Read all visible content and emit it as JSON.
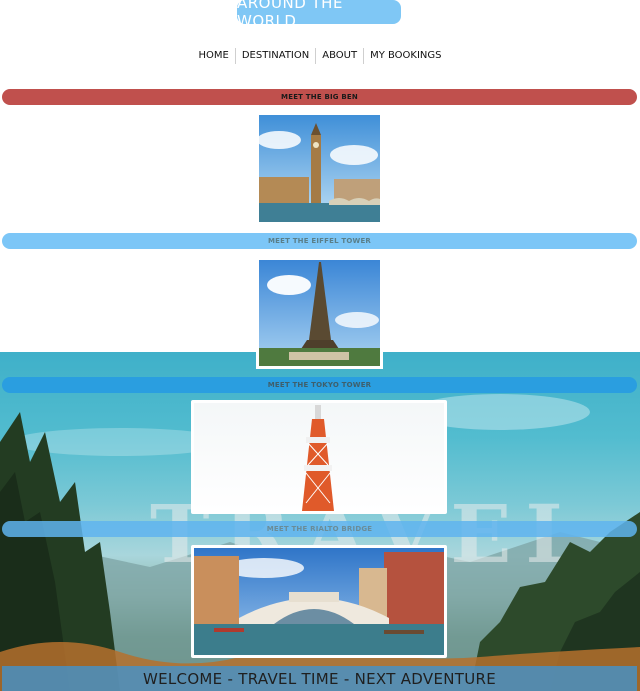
{
  "site": {
    "title": "AROUND THE WORLD",
    "title_bg": "#7fc7f5"
  },
  "nav": {
    "items": [
      "HOME",
      "DESTINATION",
      "ABOUT",
      "MY BOOKINGS"
    ]
  },
  "sections": [
    {
      "label": "MEET THE BIG BEN",
      "bar_color": "#c0504d",
      "text_color": "#1a1a1a",
      "image": "big-ben-photo"
    },
    {
      "label": "MEET THE EIFFEL TOWER",
      "bar_color": "#7cc6f7",
      "text_color": "#5a7f8a",
      "image": "eiffel-tower-photo"
    },
    {
      "label": "MEET THE TOKYO TOWER",
      "bar_color": "#2a9ee0",
      "text_color": "#3f5f6b",
      "image": "tokyo-tower-photo"
    },
    {
      "label": "MEET THE RIALTO BRIDGE",
      "bar_color": "#5fb4ee",
      "text_color": "#6a8c98",
      "image": "rialto-bridge-photo"
    }
  ],
  "background": {
    "watermark": "TRAVEL"
  },
  "footer": {
    "text": "WELCOME - TRAVEL TIME - NEXT ADVENTURE"
  }
}
